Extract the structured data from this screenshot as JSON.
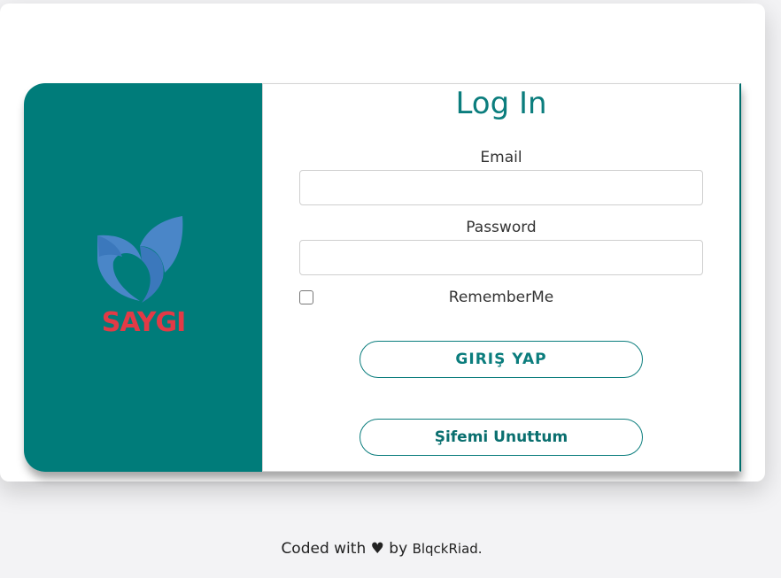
{
  "brand": {
    "logo_text": "SAYGI",
    "logo_icon": "leaf-logo-icon",
    "colors": {
      "panel": "#007c7a",
      "leaf": "#4a86c8",
      "logo_text": "#e23a46",
      "accent": "#0b7d7d"
    }
  },
  "form": {
    "title": "Log In",
    "email_label": "Email",
    "email_value": "",
    "password_label": "Password",
    "password_value": "",
    "remember_label": "RememberMe",
    "remember_checked": false,
    "login_button": "GIRIŞ YAP",
    "forgot_button": "Şifemi Unuttum"
  },
  "footer": {
    "prefix": "Coded with",
    "heart": "♥",
    "by": "by",
    "author": "BlqckRiad."
  }
}
